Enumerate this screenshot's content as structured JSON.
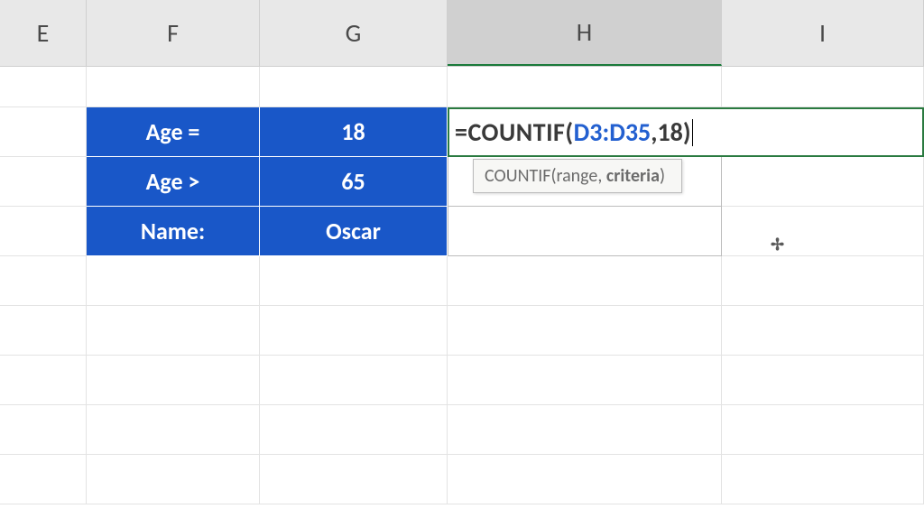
{
  "columns": {
    "E": "E",
    "F": "F",
    "G": "G",
    "H": "H",
    "I": "I"
  },
  "table": {
    "rows": [
      {
        "label": "Age =",
        "value": "18"
      },
      {
        "label": "Age >",
        "value": "65"
      },
      {
        "label": "Name:",
        "value": "Oscar"
      }
    ]
  },
  "formula": {
    "prefix": "=COUNTIF(",
    "range": "D3:D35",
    "suffix": ",18)"
  },
  "tooltip": {
    "fn": "COUNTIF",
    "open": "(",
    "arg1": "range",
    "sep": ", ",
    "arg2": "criteria",
    "close": ")"
  }
}
